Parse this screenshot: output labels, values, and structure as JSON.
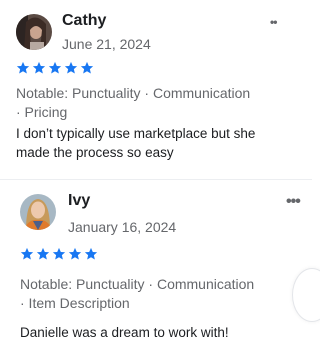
{
  "reviews": [
    {
      "name": "Cathy",
      "date": "June 21, 2024",
      "rating": 5,
      "notable_line1": "Notable: Punctuality · Communication",
      "notable_line2": "· Pricing",
      "text_line1": "I don’t typically use marketplace but she",
      "text_line2": "made the process so easy",
      "more_icon": "more-icon",
      "avatar_icon": "avatar"
    },
    {
      "name": "Ivy",
      "date": "January 16, 2024",
      "rating": 5,
      "notable_line1": "Notable: Punctuality · Communication",
      "notable_line2": "· Item Description",
      "text_line1": "Danielle was a dream to work with!",
      "more_icon": "more-icon",
      "avatar_icon": "avatar"
    }
  ],
  "colors": {
    "star": "#1877f2",
    "text": "#1c1e21",
    "secondary": "#65676b"
  }
}
